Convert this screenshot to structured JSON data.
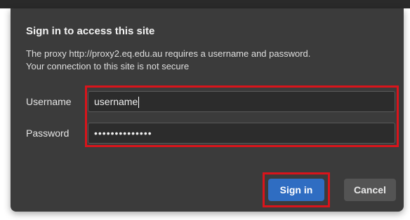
{
  "dialog": {
    "title": "Sign in to access this site",
    "description_line1": "The proxy http://proxy2.eq.edu.au requires a username and password.",
    "description_line2": "Your connection to this site is not secure",
    "username_label": "Username",
    "username_value": "username",
    "password_label": "Password",
    "password_value": "••••••••••••••",
    "signin_label": "Sign in",
    "cancel_label": "Cancel"
  },
  "colors": {
    "dialog_background": "#3b3b3b",
    "input_background": "#2c2c2c",
    "primary_button": "#2f6dc2",
    "secondary_button": "#545454",
    "highlight": "#d9141b"
  }
}
